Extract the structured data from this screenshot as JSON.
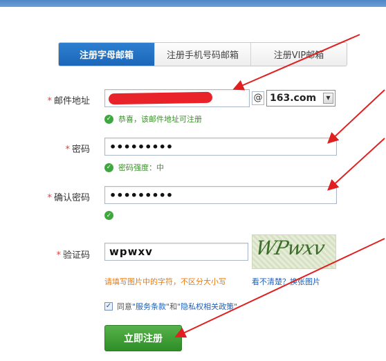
{
  "tabs": [
    {
      "label": "注册字母邮箱",
      "active": true
    },
    {
      "label": "注册手机号码邮箱",
      "active": false
    },
    {
      "label": "注册VIP邮箱",
      "active": false
    }
  ],
  "form": {
    "email_label": "邮件地址",
    "email_value": "",
    "at_sign": "@",
    "domain_value": "163.com",
    "email_ok": "恭喜，该邮件地址可注册",
    "password_label": "密码",
    "password_value": "•••••••••",
    "password_ok": "密码强度：中",
    "confirm_label": "确认密码",
    "confirm_value": "•••••••••",
    "captcha_label": "验证码",
    "captcha_value": "wpwxv",
    "captcha_image_text": "WPwxv",
    "captcha_hint": "请填写图片中的字符，不区分大小写",
    "captcha_refresh": "看不清楚？换张图片",
    "agree_prefix": "同意",
    "agree_terms": "\"服务条款\"",
    "agree_and": "和",
    "agree_privacy": "\"隐私权相关政策\"",
    "submit_label": "立即注册"
  },
  "colors": {
    "accent_blue": "#1c66b8",
    "success_green": "#3a8f2a",
    "warning_orange": "#e97b12",
    "arrow_red": "#e02020"
  }
}
